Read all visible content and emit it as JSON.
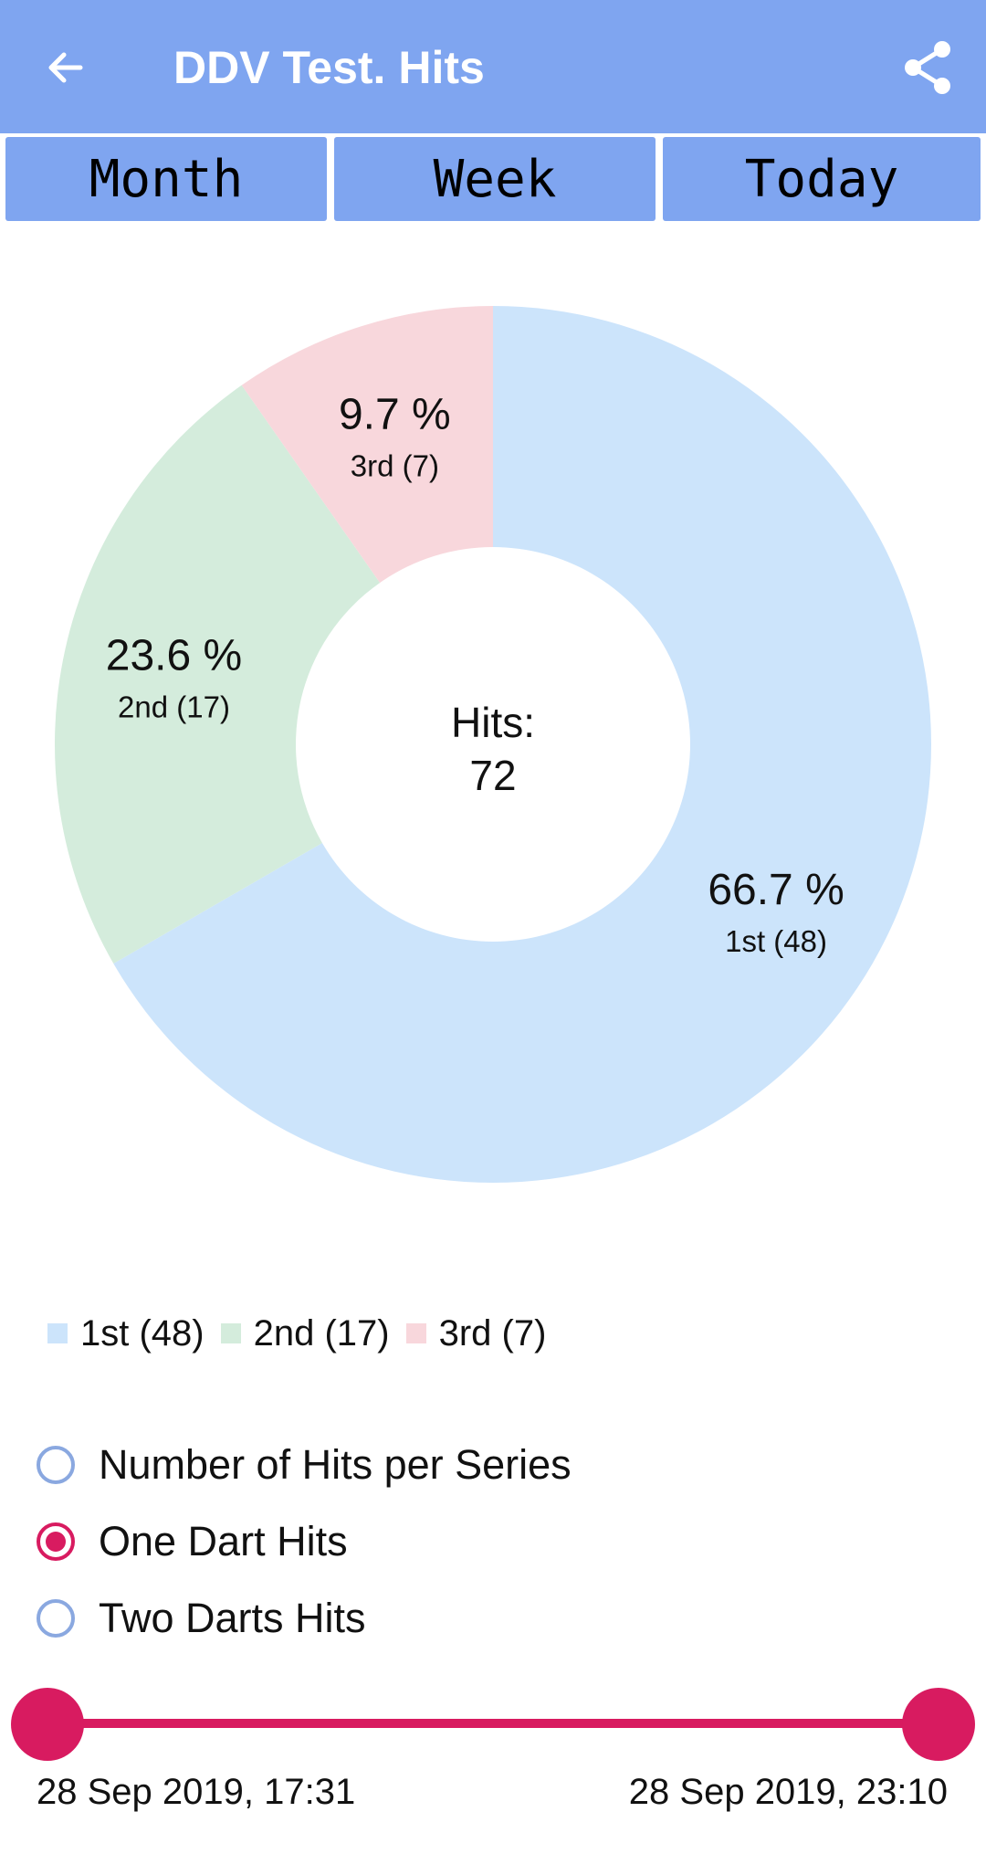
{
  "appbar": {
    "title": "DDV Test. Hits",
    "back_icon": "arrow-left-icon",
    "share_icon": "share-icon",
    "color": "#7fa5f0"
  },
  "tabs": [
    {
      "label": "Month"
    },
    {
      "label": "Week"
    },
    {
      "label": "Today"
    }
  ],
  "chart_data": {
    "type": "pie",
    "style": "donut",
    "center_label": "Hits:",
    "center_value": "72",
    "slices": [
      {
        "label": "1st (48)",
        "value": 48,
        "percent_label": "66.7 %",
        "color": "#cce4fb"
      },
      {
        "label": "2nd (17)",
        "value": 17,
        "percent_label": "23.6 %",
        "color": "#d4ecdc"
      },
      {
        "label": "3rd (7)",
        "value": 7,
        "percent_label": "9.7 %",
        "color": "#f8d7dc"
      }
    ],
    "legend": [
      "1st (48)",
      "2nd (17)",
      "3rd (7)"
    ],
    "legend_position": "bottom-left"
  },
  "radio_options": [
    {
      "label": "Number of Hits per Series",
      "checked": false
    },
    {
      "label": "One Dart Hits",
      "checked": true
    },
    {
      "label": "Two Darts Hits",
      "checked": false
    }
  ],
  "range": {
    "start_label": "28 Sep 2019, 17:31",
    "end_label": "28 Sep 2019, 23:10",
    "color": "#d81b60"
  }
}
